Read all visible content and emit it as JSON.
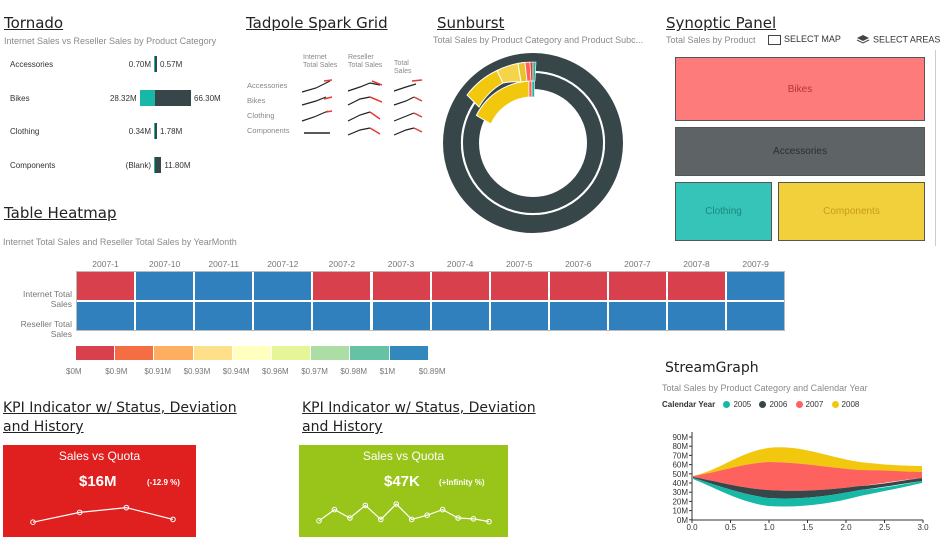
{
  "tornado": {
    "title": "Tornado",
    "subtitle": "Internet Sales vs Reseller Sales by Product Category",
    "rows": [
      {
        "category": "Accessories",
        "left_label": "0.70M",
        "right_label": "0.57M",
        "left_value": 0.7,
        "right_value": 0.57
      },
      {
        "category": "Bikes",
        "left_label": "28.32M",
        "right_label": "66.30M",
        "left_value": 28.32,
        "right_value": 66.3
      },
      {
        "category": "Clothing",
        "left_label": "0.34M",
        "right_label": "1.78M",
        "left_value": 0.34,
        "right_value": 1.78
      },
      {
        "category": "Components",
        "left_label": "(Blank)",
        "right_label": "11.80M",
        "left_value": 0,
        "right_value": 11.8
      }
    ],
    "left_color": "#17b8a6",
    "right_color": "#374649"
  },
  "tadpole": {
    "title": "Tadpole Spark Grid",
    "columns": [
      "Internet Total Sales",
      "Reseller Total Sales",
      "Total Sales"
    ],
    "rows": [
      "Accessories",
      "Bikes",
      "Clothing",
      "Components"
    ]
  },
  "sunburst": {
    "title": "Sunburst",
    "subtitle": "Total Sales by Product Category and Product Subc..."
  },
  "synoptic": {
    "title": "Synoptic Panel",
    "subtitle": "Total Sales by Product",
    "select_map": "SELECT MAP",
    "select_areas": "SELECT AREAS",
    "areas": [
      {
        "label": "Bikes",
        "color": "#fd7b7b"
      },
      {
        "label": "Accessories",
        "color": "#5e6466"
      },
      {
        "label": "Clothing",
        "color": "#35c4b7"
      },
      {
        "label": "Components",
        "color": "#f2d03b"
      }
    ]
  },
  "heatmap": {
    "title": "Table Heatmap",
    "subtitle": "Internet Total Sales and Reseller Total Sales by YearMonth",
    "columns": [
      "2007-1",
      "2007-10",
      "2007-11",
      "2007-12",
      "2007-2",
      "2007-3",
      "2007-4",
      "2007-5",
      "2007-6",
      "2007-7",
      "2007-8",
      "2007-9"
    ],
    "row_labels": [
      "Internet Total Sales",
      "Reseller Total Sales"
    ],
    "rows": [
      [
        "#d8404e",
        "#3080bd",
        "#3080bd",
        "#3080bd",
        "#d8404e",
        "#d8404e",
        "#d8404e",
        "#d8404e",
        "#d8404e",
        "#d8404e",
        "#d8404e",
        "#3080bd"
      ],
      [
        "#3080bd",
        "#3080bd",
        "#3080bd",
        "#3080bd",
        "#3080bd",
        "#3080bd",
        "#3080bd",
        "#3080bd",
        "#3080bd",
        "#3080bd",
        "#3080bd",
        "#3080bd"
      ]
    ],
    "legend_colors": [
      "#d8404e",
      "#f46d43",
      "#fdae61",
      "#fee08b",
      "#ffffbf",
      "#e6f598",
      "#abdda4",
      "#66c2a5",
      "#3288bd"
    ],
    "legend_labels": [
      "$0M",
      "$0.9M",
      "$0.91M",
      "$0.93M",
      "$0.94M",
      "$0.96M",
      "$0.97M",
      "$0.98M",
      "$1M",
      "$0.89M"
    ]
  },
  "kpi1": {
    "title_line1": "KPI Indicator w/ Status, Deviation",
    "title_line2": "and History",
    "header": "Sales vs Quota",
    "value": "$16M",
    "deviation": "(-12.9 %)",
    "color": "#e01f1f",
    "history": [
      0.1,
      0.45,
      0.62,
      0.2
    ]
  },
  "kpi2": {
    "title_line1": "KPI Indicator w/ Status, Deviation",
    "title_line2": "and History",
    "header": "Sales vs Quota",
    "value": "$47K",
    "deviation": "(+Infinity %)",
    "color": "#99c41a",
    "history": [
      0.15,
      0.55,
      0.25,
      0.7,
      0.2,
      0.75,
      0.2,
      0.35,
      0.55,
      0.25,
      0.22,
      0.12
    ]
  },
  "stream": {
    "title": "StreamGraph",
    "subtitle": "Total Sales by Product Category and Calendar Year",
    "legend_title": "Calendar Year",
    "legend": [
      {
        "name": "2005",
        "color": "#17b8a6"
      },
      {
        "name": "2006",
        "color": "#374649"
      },
      {
        "name": "2007",
        "color": "#fd625e"
      },
      {
        "name": "2008",
        "color": "#f2c80f"
      }
    ],
    "y_ticks": [
      "90M",
      "80M",
      "70M",
      "60M",
      "50M",
      "40M",
      "30M",
      "20M",
      "10M",
      "0M"
    ],
    "x_ticks": [
      "0.0",
      "0.5",
      "1.0",
      "1.5",
      "2.0",
      "2.5",
      "3.0"
    ]
  }
}
